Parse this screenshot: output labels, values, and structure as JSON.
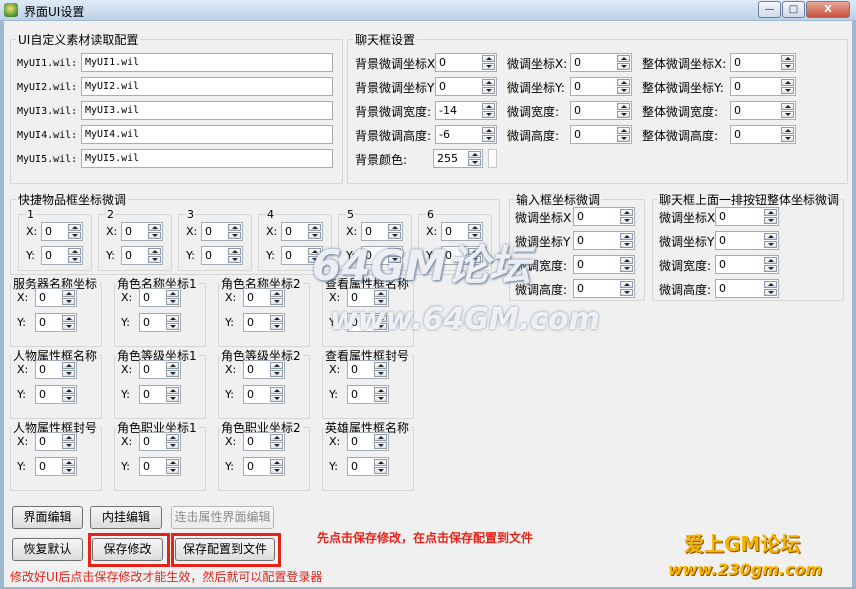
{
  "window": {
    "title": "界面UI设置",
    "minimize": "—",
    "maximize": "□",
    "close": "X"
  },
  "ui_group": {
    "label": "UI自定义素材读取配置",
    "rows": [
      {
        "label": "MyUI1.wil:",
        "value": "MyUI1.wil"
      },
      {
        "label": "MyUI2.wil:",
        "value": "MyUI2.wil"
      },
      {
        "label": "MyUI3.wil:",
        "value": "MyUI3.wil"
      },
      {
        "label": "MyUI4.wil:",
        "value": "MyUI4.wil"
      },
      {
        "label": "MyUI5.wil:",
        "value": "MyUI5.wil"
      }
    ]
  },
  "chat_group": {
    "label": "聊天框设置",
    "col1": [
      {
        "label": "背景微调坐标X",
        "value": "0"
      },
      {
        "label": "背景微调坐标Y",
        "value": "0"
      },
      {
        "label": "背景微调宽度:",
        "value": "-14"
      },
      {
        "label": "背景微调高度:",
        "value": "-6"
      },
      {
        "label": "背景颜色:",
        "value": "255"
      }
    ],
    "col2": [
      {
        "label": "微调坐标X:",
        "value": "0"
      },
      {
        "label": "微调坐标Y:",
        "value": "0"
      },
      {
        "label": "微调宽度:",
        "value": "0"
      },
      {
        "label": "微调高度:",
        "value": "0"
      }
    ],
    "col3": [
      {
        "label": "整体微调坐标X:",
        "value": "0"
      },
      {
        "label": "整体微调坐标Y:",
        "value": "0"
      },
      {
        "label": "整体微调宽度:",
        "value": "0"
      },
      {
        "label": "整体微调高度:",
        "value": "0"
      }
    ]
  },
  "quick_group": {
    "label": "快捷物品框坐标微调",
    "x_label": "X:",
    "y_label": "Y:",
    "slots": [
      {
        "num": "1",
        "x": "0",
        "y": "0"
      },
      {
        "num": "2",
        "x": "0",
        "y": "0"
      },
      {
        "num": "3",
        "x": "0",
        "y": "0"
      },
      {
        "num": "4",
        "x": "0",
        "y": "0"
      },
      {
        "num": "5",
        "x": "0",
        "y": "0"
      },
      {
        "num": "6",
        "x": "0",
        "y": "0"
      }
    ]
  },
  "input_group": {
    "label": "输入框坐标微调",
    "rows": [
      {
        "label": "微调坐标X",
        "value": "0"
      },
      {
        "label": "微调坐标Y",
        "value": "0"
      },
      {
        "label": "微调宽度:",
        "value": "0"
      },
      {
        "label": "微调高度:",
        "value": "0"
      }
    ]
  },
  "chatbtn_group": {
    "label": "聊天框上面一排按钮整体坐标微调",
    "rows": [
      {
        "label": "微调坐标X",
        "value": "0"
      },
      {
        "label": "微调坐标Y",
        "value": "0"
      },
      {
        "label": "微调宽度:",
        "value": "0"
      },
      {
        "label": "微调高度:",
        "value": "0"
      }
    ]
  },
  "coord_groups": {
    "x_label": "X:",
    "y_label": "Y:",
    "items": [
      {
        "label": "服务器名称坐标",
        "x": "0",
        "y": "0"
      },
      {
        "label": "角色名称坐标1",
        "x": "0",
        "y": "0"
      },
      {
        "label": "角色名称坐标2",
        "x": "0",
        "y": "0"
      },
      {
        "label": "查看属性框名称",
        "x": "0",
        "y": "0"
      },
      {
        "label": "人物属性框名称",
        "x": "0",
        "y": "0"
      },
      {
        "label": "角色等级坐标1",
        "x": "0",
        "y": "0"
      },
      {
        "label": "角色等级坐标2",
        "x": "0",
        "y": "0"
      },
      {
        "label": "查看属性框封号",
        "x": "0",
        "y": "0"
      },
      {
        "label": "人物属性框封号",
        "x": "0",
        "y": "0"
      },
      {
        "label": "角色职业坐标1",
        "x": "0",
        "y": "0"
      },
      {
        "label": "角色职业坐标2",
        "x": "0",
        "y": "0"
      },
      {
        "label": "英雄属性框名称",
        "x": "0",
        "y": "0"
      }
    ]
  },
  "buttons": {
    "interface_edit": "界面编辑",
    "plugin_edit": "内挂编辑",
    "attr_edit": "连击属性界面编辑",
    "restore": "恢复默认",
    "save_changes": "保存修改",
    "save_to_file": "保存配置到文件"
  },
  "hints": {
    "instruction": "先点击保存修改，在点击保存配置到文件",
    "footer": "修改好UI后点击保存修改才能生效，然后就可以配置登录器"
  },
  "watermarks": {
    "w1": "64GM论坛",
    "w2": "www.64GM.com",
    "w3": "爱上GM论坛",
    "w4": "www.230gm.com"
  },
  "colors": {
    "accent_red": "#e3241b",
    "watermark_gold": "#f5b400",
    "titlebar": "#bcd1e8"
  }
}
